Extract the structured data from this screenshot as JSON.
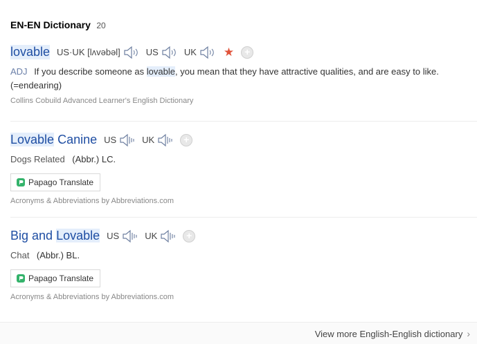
{
  "header": {
    "title": "EN-EN Dictionary",
    "count": "20"
  },
  "entries": [
    {
      "word": "lovable",
      "pron_usuk": "US·UK [lʌvəbəl]",
      "us": "US",
      "uk": "UK",
      "pos": "ADJ",
      "def_pre": "If you describe someone as",
      "def_word": "lovable",
      "def_post": ", you mean that they have attractive qualities, and are easy to like. (=endearing)",
      "source": "Collins Cobuild Advanced Learner's English Dictionary"
    },
    {
      "word_hl": "Lovable",
      "word_rest": " Canine",
      "us": "US",
      "uk": "UK",
      "category": "Dogs Related",
      "abbr": "(Abbr.) LC.",
      "translate_label": "Papago Translate",
      "source": "Acronyms & Abbreviations by Abbreviations.com"
    },
    {
      "word_pre": "Big and ",
      "word_hl": "Lovable",
      "us": "US",
      "uk": "UK",
      "category": "Chat",
      "abbr": "(Abbr.) BL.",
      "translate_label": "Papago Translate",
      "source": "Acronyms & Abbreviations by Abbreviations.com"
    }
  ],
  "footer": {
    "more_label": "View more English-English dictionary"
  },
  "colors": {
    "word": "#1f4ea3",
    "highlight": "#e4eefb",
    "star": "#e0533a"
  }
}
